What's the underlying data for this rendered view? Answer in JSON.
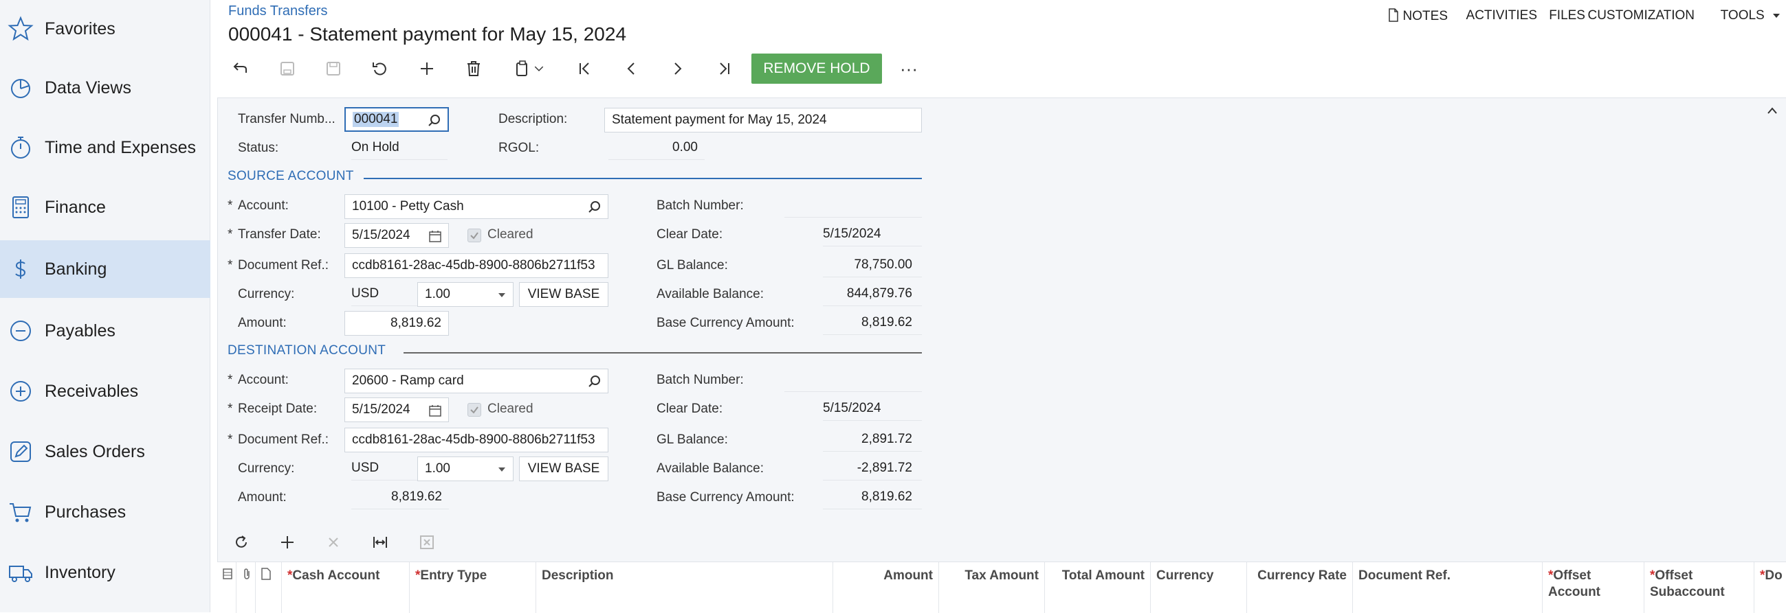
{
  "sidebar": {
    "items": [
      {
        "label": "Favorites",
        "icon": "star-icon"
      },
      {
        "label": "Data Views",
        "icon": "pie-chart-icon"
      },
      {
        "label": "Time and Expenses",
        "icon": "stopwatch-icon"
      },
      {
        "label": "Finance",
        "icon": "calculator-icon"
      },
      {
        "label": "Banking",
        "icon": "dollar-icon",
        "active": true
      },
      {
        "label": "Payables",
        "icon": "minus-circle-icon"
      },
      {
        "label": "Receivables",
        "icon": "plus-circle-icon"
      },
      {
        "label": "Sales Orders",
        "icon": "edit-icon"
      },
      {
        "label": "Purchases",
        "icon": "cart-icon"
      },
      {
        "label": "Inventory",
        "icon": "truck-icon"
      }
    ]
  },
  "header": {
    "breadcrumb": "Funds Transfers",
    "title": "000041 - Statement payment for May 15, 2024",
    "actions": {
      "notes": "NOTES",
      "activities": "ACTIVITIES",
      "files": "FILES",
      "customization": "CUSTOMIZATION",
      "tools": "TOOLS"
    }
  },
  "toolbar": {
    "remove_hold": "REMOVE HOLD",
    "more": "···"
  },
  "form": {
    "transfer_number_label": "Transfer Numb...",
    "transfer_number": "000041",
    "description_label": "Description:",
    "description": "Statement payment for May 15, 2024",
    "status_label": "Status:",
    "status": "On Hold",
    "rgol_label": "RGOL:",
    "rgol": "0.00"
  },
  "source": {
    "title": "SOURCE ACCOUNT",
    "account_label": "Account:",
    "account": "10100 - Petty Cash",
    "date_label": "Transfer Date:",
    "date": "5/15/2024",
    "cleared_label": "Cleared",
    "docref_label": "Document Ref.:",
    "docref": "ccdb8161-28ac-45db-8900-8806b2711f53",
    "currency_label": "Currency:",
    "currency": "USD",
    "rate": "1.00",
    "view_base": "VIEW BASE",
    "amount_label": "Amount:",
    "amount": "8,819.62",
    "batch_label": "Batch Number:",
    "batch": "",
    "clear_date_label": "Clear Date:",
    "clear_date": "5/15/2024",
    "gl_label": "GL Balance:",
    "gl": "78,750.00",
    "avail_label": "Available Balance:",
    "avail": "844,879.76",
    "base_amt_label": "Base Currency Amount:",
    "base_amt": "8,819.62"
  },
  "destination": {
    "title": "DESTINATION ACCOUNT",
    "account_label": "Account:",
    "account": "20600 - Ramp card",
    "date_label": "Receipt Date:",
    "date": "5/15/2024",
    "cleared_label": "Cleared",
    "docref_label": "Document Ref.:",
    "docref": "ccdb8161-28ac-45db-8900-8806b2711f53",
    "currency_label": "Currency:",
    "currency": "USD",
    "rate": "1.00",
    "view_base": "VIEW BASE",
    "amount_label": "Amount:",
    "amount": "8,819.62",
    "batch_label": "Batch Number:",
    "batch": "",
    "clear_date_label": "Clear Date:",
    "clear_date": "5/15/2024",
    "gl_label": "GL Balance:",
    "gl": "2,891.72",
    "avail_label": "Available Balance:",
    "avail": "-2,891.72",
    "base_amt_label": "Base Currency Amount:",
    "base_amt": "8,819.62"
  },
  "grid": {
    "columns": [
      {
        "label": "Cash Account",
        "required": true
      },
      {
        "label": "Entry Type",
        "required": true
      },
      {
        "label": "Description",
        "required": false
      },
      {
        "label": "Amount",
        "required": false
      },
      {
        "label": "Tax Amount",
        "required": false
      },
      {
        "label": "Total Amount",
        "required": false
      },
      {
        "label": "Currency",
        "required": false
      },
      {
        "label": "Currency Rate",
        "required": false
      },
      {
        "label": "Document Ref.",
        "required": false
      },
      {
        "label": "Offset Account",
        "required": true
      },
      {
        "label": "Offset Subaccount",
        "required": true
      },
      {
        "label": "Do",
        "required": true
      }
    ]
  },
  "colors": {
    "accent": "#2f6db5",
    "active_nav": "#d5e3f4",
    "remove_hold": "#5aa85a",
    "required_star": "#d03030"
  }
}
